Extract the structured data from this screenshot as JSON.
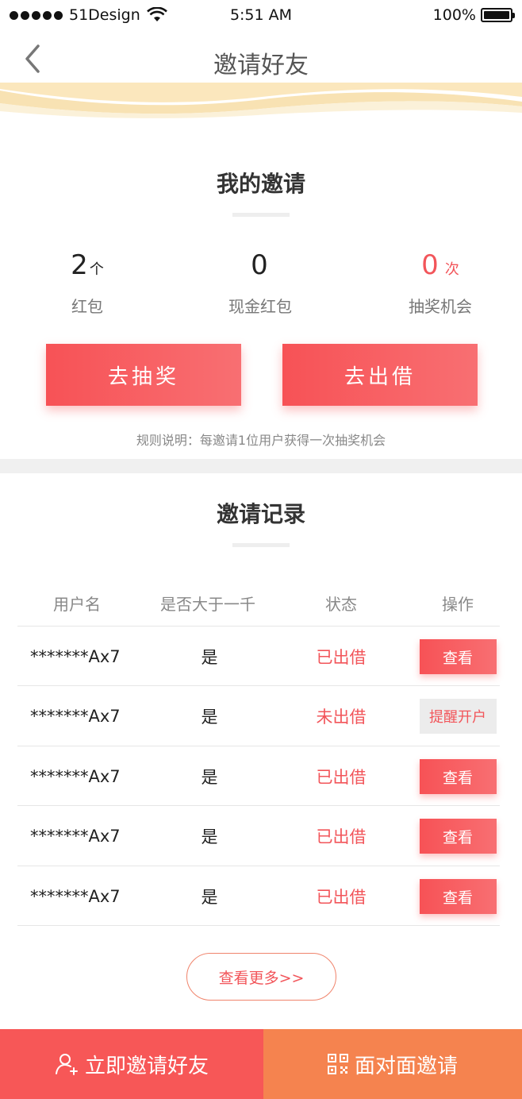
{
  "status_bar": {
    "carrier": "51Design",
    "time": "5:51 AM",
    "battery": "100%"
  },
  "nav": {
    "title": "邀请好友"
  },
  "my_invite": {
    "title": "我的邀请",
    "stats": [
      {
        "value": "2",
        "unit": "个",
        "label": "红包"
      },
      {
        "value": "0",
        "unit": "",
        "label": "现金红包"
      },
      {
        "value": "0",
        "unit": "次",
        "label": "抽奖机会"
      }
    ],
    "lottery_button": "去抽奖",
    "lend_button": "去出借",
    "rule": "规则说明：每邀请1位用户获得一次抽奖机会"
  },
  "records": {
    "title": "邀请记录",
    "headers": [
      "用户名",
      "是否大于一千",
      "状态",
      "操作"
    ],
    "rows": [
      {
        "user": "*******Ax7",
        "over_1000": "是",
        "status": "已出借",
        "action": "查看"
      },
      {
        "user": "*******Ax7",
        "over_1000": "是",
        "status": "未出借",
        "action": "提醒开户"
      },
      {
        "user": "*******Ax7",
        "over_1000": "是",
        "status": "已出借",
        "action": "查看"
      },
      {
        "user": "*******Ax7",
        "over_1000": "是",
        "status": "已出借",
        "action": "查看"
      },
      {
        "user": "*******Ax7",
        "over_1000": "是",
        "status": "已出借",
        "action": "查看"
      }
    ],
    "more_button": "查看更多>>"
  },
  "bottom": {
    "invite_now": "立即邀请好友",
    "face_to_face": "面对面邀请"
  },
  "colors": {
    "accent_red": "#f75256",
    "accent_orange": "#f5834f",
    "wave_gold": "#f3d38e"
  }
}
